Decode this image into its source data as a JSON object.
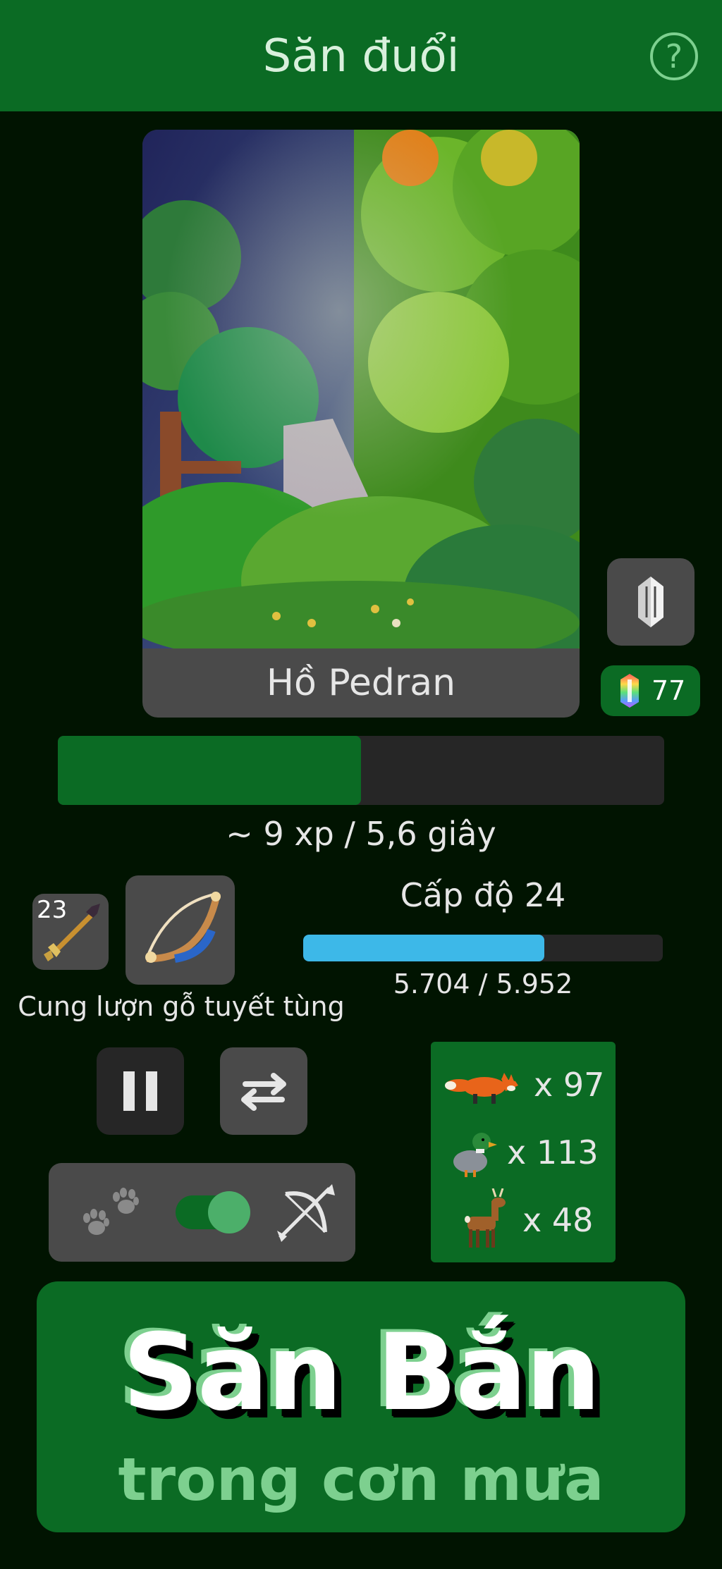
{
  "header": {
    "title": "Săn đuổi",
    "help_icon": "question-circle-icon",
    "help_glyph": "?"
  },
  "scene": {
    "location_name": "Hồ Pedran",
    "image": "rainy-forest-pixel-art"
  },
  "crystal_button": {
    "icon": "crystal-icon"
  },
  "gems": {
    "icon": "rainbow-crystal-icon",
    "count": "77"
  },
  "activity": {
    "progress_fraction": 0.5,
    "rate_text": "~ 9 xp / 5,6 giây"
  },
  "equipment": {
    "ammo": {
      "icon": "arrow-icon",
      "count": "23"
    },
    "weapon": {
      "icon": "bow-icon",
      "name": "Cung lượn gỗ tuyết tùng"
    }
  },
  "level": {
    "label": "Cấp độ 24",
    "current": 5704,
    "max": 5952,
    "progress_text": "5.704 / 5.952"
  },
  "controls": {
    "pause_icon": "pause-icon",
    "switch_icon": "swap-arrows-icon",
    "mode_left_icon": "paw-prints-icon",
    "mode_toggle_on": true,
    "mode_right_icon": "bow-arrow-icon"
  },
  "loot": [
    {
      "icon": "fox-icon",
      "count": "x 97"
    },
    {
      "icon": "duck-icon",
      "count": "x 113"
    },
    {
      "icon": "deer-icon",
      "count": "x 48"
    }
  ],
  "promo": {
    "title": "Săn Bắn",
    "subtitle": "trong cơn mưa"
  },
  "colors": {
    "background": "#011401",
    "primary_green": "#0b6b24",
    "accent_light_green": "#7dd08f",
    "panel_gray": "#4a4a4a",
    "dark_gray": "#262626",
    "level_blue": "#3db8e8"
  }
}
